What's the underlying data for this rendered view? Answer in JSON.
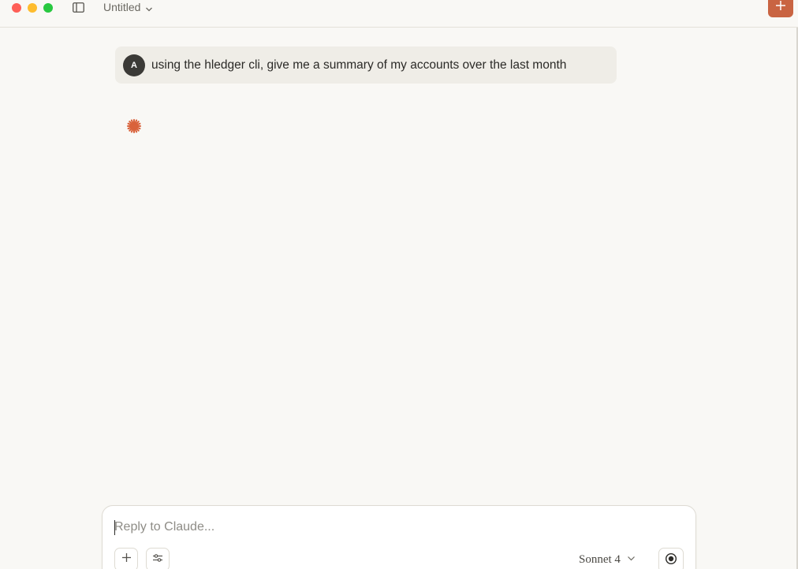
{
  "window": {
    "title": "Untitled"
  },
  "conversation": {
    "user_message": {
      "avatar_initial": "A",
      "text": "using the hledger cli, give me a summary of my accounts over the last month"
    },
    "assistant_status_icon": "claude-spark-icon"
  },
  "composer": {
    "placeholder": "Reply to Claude...",
    "value": "",
    "model_label": "Sonnet 4"
  },
  "icons": {
    "sidebar_toggle": "sidebar-toggle-icon",
    "title_dropdown": "chevron-down-icon",
    "new_chat": "plus-icon",
    "attach": "plus-icon",
    "tools": "sliders-icon",
    "model_dropdown": "chevron-down-icon",
    "voice": "voice-record-icon"
  },
  "colors": {
    "accent": "#c96442",
    "background": "#f9f8f5",
    "bubble": "#efede7",
    "avatar": "#3b3a37"
  }
}
